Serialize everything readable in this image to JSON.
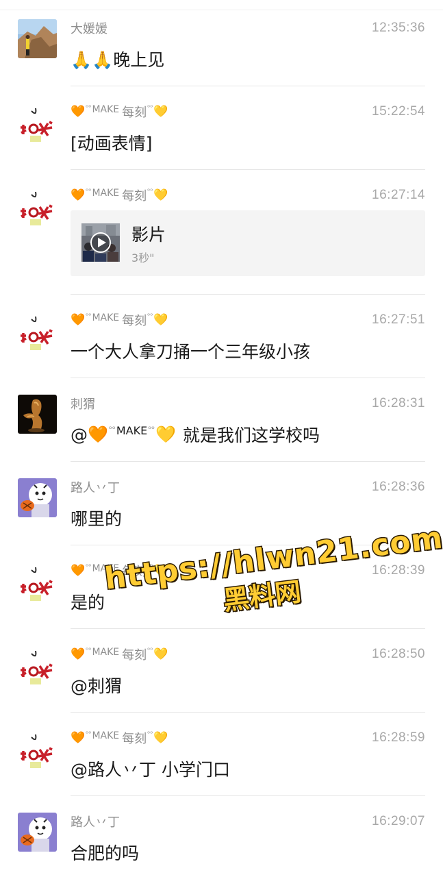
{
  "colors": {
    "name_gray": "#8e8e8e",
    "time_gray": "#a8a8a8",
    "text_black": "#191919",
    "divider": "#e6e6e6",
    "card_bg": "#f4f4f4",
    "watermark_fill": "#ffcc33"
  },
  "messages": [
    {
      "sender": "大媛媛",
      "time": "12:35:36",
      "text": "🙏🙏晚上见",
      "avatar": "mountain-photo-avatar"
    },
    {
      "sender_make": "MAKE",
      "sender_suffix": "每刻",
      "time": "15:22:54",
      "text": "[动画表情]",
      "avatar": "calligraphy-avatar"
    },
    {
      "sender_make": "MAKE",
      "sender_suffix": "每刻",
      "time": "16:27:14",
      "video": {
        "title": "影片",
        "duration": "3秒\""
      },
      "avatar": "calligraphy-avatar"
    },
    {
      "sender_make": "MAKE",
      "sender_suffix": "每刻",
      "time": "16:27:51",
      "text": "一个大人拿刀捅一个三年级小孩",
      "avatar": "calligraphy-avatar"
    },
    {
      "sender": "刺猬",
      "time": "16:28:31",
      "mention_prefix": "@",
      "mention_make": "MAKE",
      "text_after": "就是我们这学校吗",
      "avatar": "sculpture-avatar"
    },
    {
      "sender": "路人丷丁",
      "time": "16:28:36",
      "text": "哪里的",
      "avatar": "cartoon-avatar"
    },
    {
      "sender_make": "MAKE",
      "sender_suffix": "每刻",
      "time": "16:28:39",
      "text": "是的",
      "avatar": "calligraphy-avatar"
    },
    {
      "sender_make": "MAKE",
      "sender_suffix": "每刻",
      "time": "16:28:50",
      "text": "@刺猬",
      "avatar": "calligraphy-avatar"
    },
    {
      "sender_make": "MAKE",
      "sender_suffix": "每刻",
      "time": "16:28:59",
      "text": "@路人丷丁 小学门口",
      "avatar": "calligraphy-avatar"
    },
    {
      "sender": "路人丷丁",
      "time": "16:29:07",
      "text": "合肥的吗",
      "avatar": "cartoon-avatar"
    }
  ],
  "watermark": {
    "url": "https://hlwn21.com",
    "name": "黑料网"
  },
  "icons": {
    "orange_heart": "🧡",
    "yellow_heart": "💛",
    "play": "play-icon"
  }
}
